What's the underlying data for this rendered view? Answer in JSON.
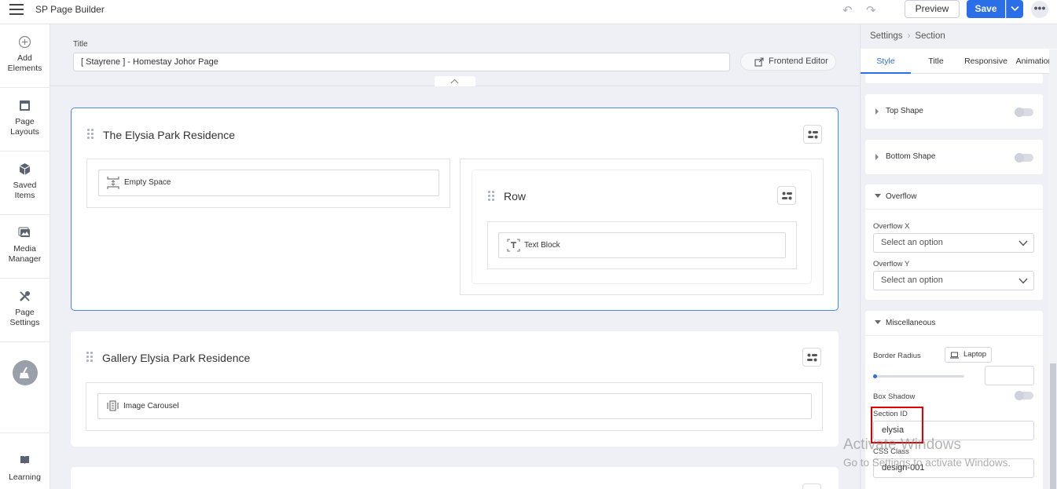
{
  "app": {
    "title": "SP Page Builder"
  },
  "toolbar": {
    "preview_label": "Preview",
    "save_label": "Save",
    "more_label": "•••"
  },
  "rail": {
    "items": [
      {
        "label_line1": "Add",
        "label_line2": "Elements",
        "icon": "plus-circle-icon"
      },
      {
        "label_line1": "Page",
        "label_line2": "Layouts",
        "icon": "layout-icon"
      },
      {
        "label_line1": "Saved",
        "label_line2": "Items",
        "icon": "box-icon"
      },
      {
        "label_line1": "Media",
        "label_line2": "Manager",
        "icon": "media-icon"
      },
      {
        "label_line1": "Page",
        "label_line2": "Settings",
        "icon": "tools-icon"
      }
    ],
    "learning_label": "Learning"
  },
  "page": {
    "title_label": "Title",
    "title_value": "[ Stayrene ] - Homestay Johor Page",
    "frontend_editor_label": "Frontend Editor"
  },
  "canvas": {
    "section1": {
      "title": "The Elysia Park Residence",
      "addon_empty_space": "Empty Space",
      "row_title": "Row",
      "addon_text_block": "Text Block"
    },
    "section2": {
      "title": "Gallery Elysia Park Residence",
      "addon_image_carousel": "Image Carousel"
    }
  },
  "panel": {
    "breadcrumb_root": "Settings",
    "breadcrumb_current": "Section",
    "tabs": [
      "Style",
      "Title",
      "Responsive",
      "Animation"
    ],
    "active_tab": "Style",
    "top_shape_label": "Top Shape",
    "bottom_shape_label": "Bottom Shape",
    "overflow": {
      "title": "Overflow",
      "overflow_x_label": "Overflow X",
      "overflow_x_placeholder": "Select an option",
      "overflow_y_label": "Overflow Y",
      "overflow_y_placeholder": "Select an option"
    },
    "misc": {
      "title": "Miscellaneous",
      "border_radius_label": "Border Radius",
      "device_label": "Laptop",
      "box_shadow_label": "Box Shadow",
      "section_id_label": "Section ID",
      "section_id_value": "elysia",
      "css_class_label": "CSS Class",
      "css_class_value": "design-001"
    }
  },
  "watermark": {
    "line1": "Activate Windows",
    "line2": "Go to Settings to activate Windows."
  },
  "colors": {
    "accent": "#2a6ee8",
    "highlight": "#e00000"
  }
}
